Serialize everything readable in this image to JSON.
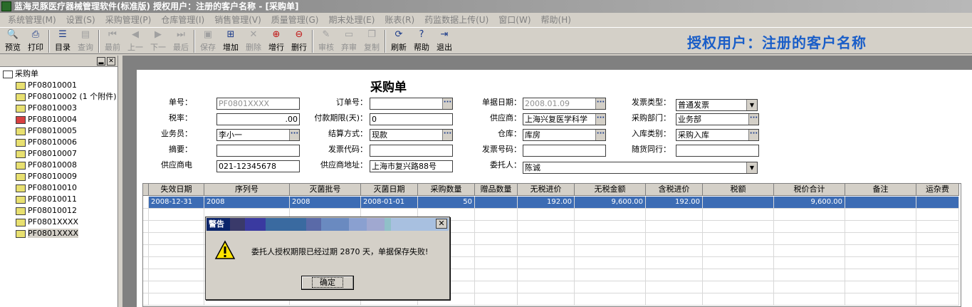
{
  "window": {
    "title": "蓝海灵豚医疗器械管理软件(标准版)  授权用户：注册的客户名称 - [采购单]"
  },
  "menu": {
    "items": [
      "系统管理(M)",
      "设置(S)",
      "采购管理(P)",
      "仓库管理(I)",
      "销售管理(V)",
      "质量管理(G)",
      "期末处理(E)",
      "账表(R)",
      "药监数据上传(U)",
      "窗口(W)",
      "帮助(H)"
    ]
  },
  "toolbar": {
    "buttons": [
      {
        "label": "预览",
        "icon": "preview-icon",
        "enabled": true
      },
      {
        "label": "打印",
        "icon": "printer-icon",
        "enabled": true
      },
      {
        "label": "目录",
        "icon": "list-icon",
        "enabled": true
      },
      {
        "label": "查询",
        "icon": "query-icon",
        "enabled": false
      },
      {
        "label": "最前",
        "icon": "first-icon",
        "enabled": false
      },
      {
        "label": "上一",
        "icon": "prev-icon",
        "enabled": false
      },
      {
        "label": "下一",
        "icon": "next-icon",
        "enabled": false
      },
      {
        "label": "最后",
        "icon": "last-icon",
        "enabled": false
      },
      {
        "label": "保存",
        "icon": "save-icon",
        "enabled": false
      },
      {
        "label": "增加",
        "icon": "add-icon",
        "enabled": true
      },
      {
        "label": "删除",
        "icon": "delete-icon",
        "enabled": false
      },
      {
        "label": "增行",
        "icon": "add-row-icon",
        "enabled": true
      },
      {
        "label": "删行",
        "icon": "delete-row-icon",
        "enabled": true
      },
      {
        "label": "审核",
        "icon": "audit-icon",
        "enabled": false
      },
      {
        "label": "弃审",
        "icon": "unaudit-icon",
        "enabled": false
      },
      {
        "label": "复制",
        "icon": "copy-icon",
        "enabled": false
      },
      {
        "label": "刷新",
        "icon": "refresh-icon",
        "enabled": true
      },
      {
        "label": "帮助",
        "icon": "help-icon",
        "enabled": true
      },
      {
        "label": "退出",
        "icon": "exit-icon",
        "enabled": true
      }
    ]
  },
  "banner": {
    "text": "授权用户：注册的客户名称"
  },
  "tree": {
    "root": "采购单",
    "items": [
      "PF08010001",
      "PF08010002 (1 个附件)",
      "PF08010003",
      "PF08010004",
      "PF08010005",
      "PF08010006",
      "PF08010007",
      "PF08010008",
      "PF08010009",
      "PF08010010",
      "PF08010011",
      "PF08010012",
      "PF0801XXXX",
      "PF0801XXXX"
    ]
  },
  "form": {
    "title": "采购单",
    "fields": {
      "doc_no": {
        "label": "单号：",
        "value": "PF0801XXXX"
      },
      "order_no": {
        "label": "订单号：",
        "value": ""
      },
      "doc_date": {
        "label": "单据日期：",
        "value": "2008.01.09"
      },
      "invoice_type": {
        "label": "发票类型：",
        "value": "普通发票"
      },
      "tax_rate": {
        "label": "税率：",
        "value": ".00"
      },
      "pay_days": {
        "label": "付款期限(天)：",
        "value": "0"
      },
      "supplier": {
        "label": "供应商：",
        "value": "上海兴复医学科学"
      },
      "purchase_dept": {
        "label": "采购部门：",
        "value": "业务部"
      },
      "salesman": {
        "label": "业务员：",
        "value": "李小一"
      },
      "settlement": {
        "label": "结算方式：",
        "value": "现款"
      },
      "warehouse": {
        "label": "仓库：",
        "value": "库房"
      },
      "stock_in_type": {
        "label": "入库类别：",
        "value": "采购入库"
      },
      "summary": {
        "label": "摘要：",
        "value": ""
      },
      "invoice_code": {
        "label": "发票代码：",
        "value": ""
      },
      "invoice_no": {
        "label": "发票号码：",
        "value": ""
      },
      "with_goods": {
        "label": "随货同行：",
        "value": ""
      },
      "supplier_phone": {
        "label": "供应商电",
        "value": "021-12345678"
      },
      "supplier_address": {
        "label": "供应商地址：",
        "value": "上海市复兴路88号"
      },
      "consignee": {
        "label": "委托人：",
        "value": "陈诚"
      }
    }
  },
  "grid": {
    "columns": [
      "失效日期",
      "序列号",
      "灭菌批号",
      "灭菌日期",
      "采购数量",
      "赠品数量",
      "无税进价",
      "无税金额",
      "含税进价",
      "税额",
      "税价合计",
      "备注",
      "运杂费"
    ],
    "rows": [
      [
        "2008-12-31",
        "2008",
        "2008",
        "2008-01-01",
        "50",
        "",
        "192.00",
        "9,600.00",
        "192.00",
        "",
        "9,600.00",
        "",
        ""
      ]
    ]
  },
  "dialog": {
    "title": "警告",
    "message": "委托人授权期限已经过期 2870 天，单据保存失败!",
    "ok": "确定"
  },
  "colors": {
    "banner": "#1a5ec8",
    "selection": "#3c6cb4",
    "dialog_title": "#0a246a"
  }
}
